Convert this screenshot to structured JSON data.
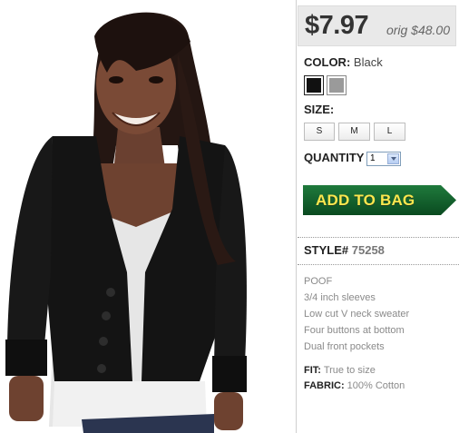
{
  "product": {
    "price": "$7.97",
    "orig_price": "orig $48.00",
    "color_label": "COLOR:",
    "color_value": "Black",
    "swatches": [
      {
        "name": "Black",
        "hex": "#111111"
      },
      {
        "name": "Grey",
        "hex": "#9a9a9a"
      }
    ],
    "size_label": "SIZE:",
    "sizes": [
      "S",
      "M",
      "L"
    ],
    "quantity_label": "QUANTITY",
    "quantity_value": "1",
    "add_to_bag": "ADD TO BAG",
    "style_label": "STYLE#",
    "style_number": "75258",
    "description": [
      "POOF",
      "3/4 inch sleeves",
      "Low cut V neck sweater",
      "Four buttons at bottom",
      "Dual front pockets"
    ],
    "fit_label": "FIT:",
    "fit_value": "True to size",
    "fabric_label": "FABRIC:",
    "fabric_value": "100% Cotton"
  },
  "colors": {
    "button_green": "#0f5d2a",
    "button_text": "#fbe74e",
    "price_bg": "#e9e9e9"
  }
}
